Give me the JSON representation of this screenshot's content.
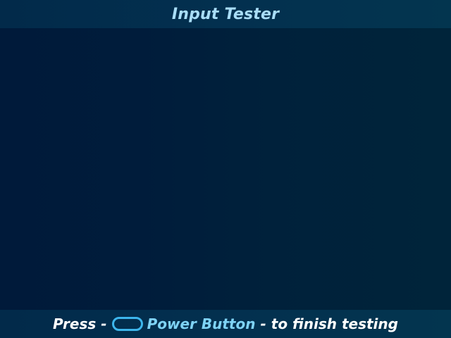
{
  "header": {
    "title": "Input Tester"
  },
  "footer": {
    "press_label": "Press",
    "separator_before": "-",
    "button_icon": "power-button-icon",
    "button_name": "Power Button",
    "separator_after": "-",
    "action_text": "to finish testing"
  },
  "colors": {
    "background": "#001c3b",
    "bar": "#03304f",
    "title_text": "#a9ddf7",
    "accent": "#7fd3f5",
    "icon_outline": "#3db6ec"
  }
}
